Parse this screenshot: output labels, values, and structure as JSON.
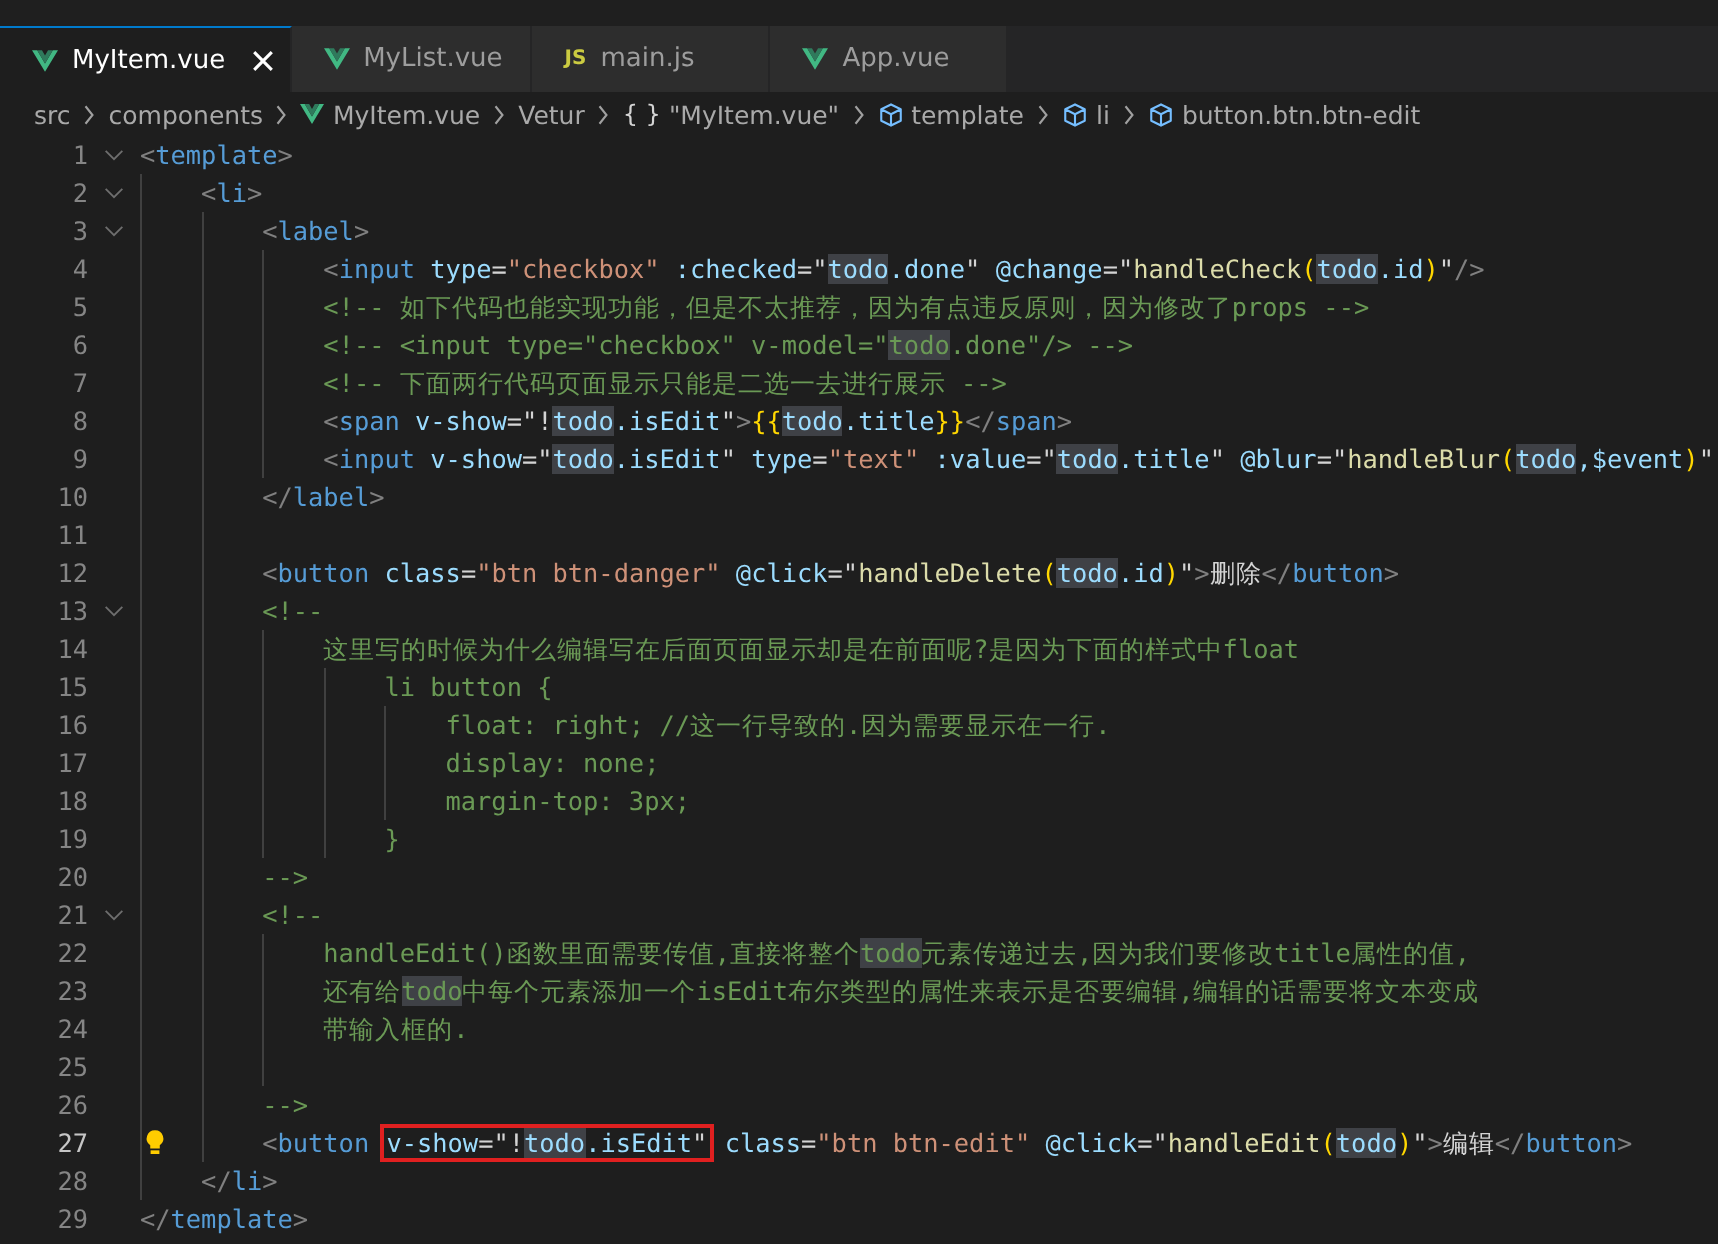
{
  "tabs": [
    {
      "label": "MyItem.vue",
      "kind": "vue",
      "selected": true
    },
    {
      "label": "MyList.vue",
      "kind": "vue",
      "selected": false
    },
    {
      "label": "main.js",
      "kind": "js",
      "icon_text": "JS",
      "selected": false
    },
    {
      "label": "App.vue",
      "kind": "vue",
      "selected": false
    }
  ],
  "breadcrumb": [
    {
      "label": "src"
    },
    {
      "label": "components"
    },
    {
      "label": "MyItem.vue",
      "kind": "vue"
    },
    {
      "label": "Vetur"
    },
    {
      "label": "\"MyItem.vue\"",
      "kind": "braces",
      "icon_text": "{ }"
    },
    {
      "label": "template",
      "kind": "symbol"
    },
    {
      "label": "li",
      "kind": "symbol"
    },
    {
      "label": "button.btn.btn-edit",
      "kind": "symbol"
    }
  ],
  "editor": {
    "lines": [
      {
        "number": "1",
        "foldable": true,
        "current": false,
        "lightbulb": false,
        "tokens": [
          {
            "kind": "punct",
            "text": "<"
          },
          {
            "kind": "tag",
            "text": "template"
          },
          {
            "kind": "punct",
            "text": ">"
          }
        ]
      },
      {
        "number": "2",
        "foldable": true,
        "current": false,
        "lightbulb": false,
        "tokens": [
          {
            "kind": "punct",
            "text": "    <"
          },
          {
            "kind": "tag",
            "text": "li"
          },
          {
            "kind": "punct",
            "text": ">"
          }
        ]
      },
      {
        "number": "3",
        "foldable": true,
        "current": false,
        "lightbulb": false,
        "tokens": [
          {
            "kind": "punct",
            "text": "        <"
          },
          {
            "kind": "tag",
            "text": "label"
          },
          {
            "kind": "punct",
            "text": ">"
          }
        ]
      },
      {
        "number": "4",
        "foldable": false,
        "current": false,
        "lightbulb": false,
        "tokens": [
          {
            "kind": "punct",
            "text": "            <"
          },
          {
            "kind": "tag",
            "text": "input"
          },
          {
            "kind": "attr",
            "text": " type"
          },
          {
            "kind": "plain",
            "text": "="
          },
          {
            "kind": "str",
            "text": "\"checkbox\""
          },
          {
            "kind": "attr",
            "text": " :checked"
          },
          {
            "kind": "plain",
            "text": "=\""
          },
          {
            "kind": "match",
            "text": "todo"
          },
          {
            "kind": "var",
            "text": ".done"
          },
          {
            "kind": "plain",
            "text": "\" "
          },
          {
            "kind": "attr",
            "text": "@change"
          },
          {
            "kind": "plain",
            "text": "=\""
          },
          {
            "kind": "func",
            "text": "handleCheck"
          },
          {
            "kind": "brace",
            "text": "("
          },
          {
            "kind": "match",
            "text": "todo"
          },
          {
            "kind": "var",
            "text": ".id"
          },
          {
            "kind": "brace",
            "text": ")"
          },
          {
            "kind": "plain",
            "text": "\""
          },
          {
            "kind": "punct",
            "text": "/>"
          }
        ]
      },
      {
        "number": "5",
        "foldable": false,
        "current": false,
        "lightbulb": false,
        "tokens": [
          {
            "kind": "comment",
            "text": "            <!-- 如下代码也能实现功能，但是不太推荐，因为有点违反原则，因为修改了props -->"
          }
        ]
      },
      {
        "number": "6",
        "foldable": false,
        "current": false,
        "lightbulb": false,
        "tokens": [
          {
            "kind": "comment",
            "text": "            <!-- <input type=\"checkbox\" v-model=\""
          },
          {
            "kind": "cmatch",
            "text": "todo"
          },
          {
            "kind": "comment",
            "text": ".done\"/> -->"
          }
        ]
      },
      {
        "number": "7",
        "foldable": false,
        "current": false,
        "lightbulb": false,
        "tokens": [
          {
            "kind": "comment",
            "text": "            <!-- 下面两行代码页面显示只能是二选一去进行展示 -->"
          }
        ]
      },
      {
        "number": "8",
        "foldable": false,
        "current": false,
        "lightbulb": false,
        "tokens": [
          {
            "kind": "punct",
            "text": "            <"
          },
          {
            "kind": "tag",
            "text": "span"
          },
          {
            "kind": "attr",
            "text": " v-show"
          },
          {
            "kind": "plain",
            "text": "=\"!"
          },
          {
            "kind": "match",
            "text": "todo"
          },
          {
            "kind": "var",
            "text": ".isEdit"
          },
          {
            "kind": "plain",
            "text": "\""
          },
          {
            "kind": "punct",
            "text": ">"
          },
          {
            "kind": "brace",
            "text": "{{"
          },
          {
            "kind": "match",
            "text": "todo"
          },
          {
            "kind": "var",
            "text": ".title"
          },
          {
            "kind": "brace",
            "text": "}}"
          },
          {
            "kind": "punct",
            "text": "</"
          },
          {
            "kind": "tag",
            "text": "span"
          },
          {
            "kind": "punct",
            "text": ">"
          }
        ]
      },
      {
        "number": "9",
        "foldable": false,
        "current": false,
        "lightbulb": false,
        "tokens": [
          {
            "kind": "punct",
            "text": "            <"
          },
          {
            "kind": "tag",
            "text": "input"
          },
          {
            "kind": "attr",
            "text": " v-show"
          },
          {
            "kind": "plain",
            "text": "=\""
          },
          {
            "kind": "match",
            "text": "todo"
          },
          {
            "kind": "var",
            "text": ".isEdit"
          },
          {
            "kind": "plain",
            "text": "\" "
          },
          {
            "kind": "attr",
            "text": "type"
          },
          {
            "kind": "plain",
            "text": "="
          },
          {
            "kind": "str",
            "text": "\"text\""
          },
          {
            "kind": "attr",
            "text": " :value"
          },
          {
            "kind": "plain",
            "text": "=\""
          },
          {
            "kind": "match",
            "text": "todo"
          },
          {
            "kind": "var",
            "text": ".title"
          },
          {
            "kind": "plain",
            "text": "\" "
          },
          {
            "kind": "attr",
            "text": "@blur"
          },
          {
            "kind": "plain",
            "text": "=\""
          },
          {
            "kind": "func",
            "text": "handleBlur"
          },
          {
            "kind": "brace",
            "text": "("
          },
          {
            "kind": "match",
            "text": "todo"
          },
          {
            "kind": "var",
            "text": ",$event"
          },
          {
            "kind": "brace",
            "text": ")"
          },
          {
            "kind": "plain",
            "text": "\""
          }
        ]
      },
      {
        "number": "10",
        "foldable": false,
        "current": false,
        "lightbulb": false,
        "tokens": [
          {
            "kind": "punct",
            "text": "        </"
          },
          {
            "kind": "tag",
            "text": "label"
          },
          {
            "kind": "punct",
            "text": ">"
          }
        ]
      },
      {
        "number": "11",
        "foldable": false,
        "current": false,
        "lightbulb": false
      },
      {
        "number": "12",
        "foldable": false,
        "current": false,
        "lightbulb": false,
        "tokens": [
          {
            "kind": "punct",
            "text": "        <"
          },
          {
            "kind": "tag",
            "text": "button"
          },
          {
            "kind": "attr",
            "text": " class"
          },
          {
            "kind": "plain",
            "text": "="
          },
          {
            "kind": "str",
            "text": "\"btn btn-danger\""
          },
          {
            "kind": "attr",
            "text": " @click"
          },
          {
            "kind": "plain",
            "text": "=\""
          },
          {
            "kind": "func",
            "text": "handleDelete"
          },
          {
            "kind": "brace",
            "text": "("
          },
          {
            "kind": "match",
            "text": "todo"
          },
          {
            "kind": "var",
            "text": ".id"
          },
          {
            "kind": "brace",
            "text": ")"
          },
          {
            "kind": "plain",
            "text": "\""
          },
          {
            "kind": "punct",
            "text": ">"
          },
          {
            "kind": "plain",
            "text": "删除"
          },
          {
            "kind": "punct",
            "text": "</"
          },
          {
            "kind": "tag",
            "text": "button"
          },
          {
            "kind": "punct",
            "text": ">"
          }
        ]
      },
      {
        "number": "13",
        "foldable": true,
        "current": false,
        "lightbulb": false,
        "tokens": [
          {
            "kind": "comment",
            "text": "        <!--"
          }
        ]
      },
      {
        "number": "14",
        "foldable": false,
        "current": false,
        "lightbulb": false,
        "tokens": [
          {
            "kind": "comment",
            "text": "            这里写的时候为什么编辑写在后面页面显示却是在前面呢?是因为下面的样式中float"
          }
        ]
      },
      {
        "number": "15",
        "foldable": false,
        "current": false,
        "lightbulb": false,
        "tokens": [
          {
            "kind": "comment",
            "text": "                li button {"
          }
        ]
      },
      {
        "number": "16",
        "foldable": false,
        "current": false,
        "lightbulb": false,
        "tokens": [
          {
            "kind": "comment",
            "text": "                    float: right; //这一行导致的.因为需要显示在一行."
          }
        ]
      },
      {
        "number": "17",
        "foldable": false,
        "current": false,
        "lightbulb": false,
        "tokens": [
          {
            "kind": "comment",
            "text": "                    display: none;"
          }
        ]
      },
      {
        "number": "18",
        "foldable": false,
        "current": false,
        "lightbulb": false,
        "tokens": [
          {
            "kind": "comment",
            "text": "                    margin-top: 3px;"
          }
        ]
      },
      {
        "number": "19",
        "foldable": false,
        "current": false,
        "lightbulb": false,
        "tokens": [
          {
            "kind": "comment",
            "text": "                }"
          }
        ]
      },
      {
        "number": "20",
        "foldable": false,
        "current": false,
        "lightbulb": false,
        "tokens": [
          {
            "kind": "comment",
            "text": "        -->"
          }
        ]
      },
      {
        "number": "21",
        "foldable": true,
        "current": false,
        "lightbulb": false,
        "tokens": [
          {
            "kind": "comment",
            "text": "        <!--"
          }
        ]
      },
      {
        "number": "22",
        "foldable": false,
        "current": false,
        "lightbulb": false,
        "tokens": [
          {
            "kind": "comment",
            "text": "            handleEdit()函数里面需要传值,直接将整个"
          },
          {
            "kind": "cmatch",
            "text": "todo"
          },
          {
            "kind": "comment",
            "text": "元素传递过去,因为我们要修改title属性的值,"
          }
        ]
      },
      {
        "number": "23",
        "foldable": false,
        "current": false,
        "lightbulb": false,
        "tokens": [
          {
            "kind": "comment",
            "text": "            还有给"
          },
          {
            "kind": "cmatch",
            "text": "todo"
          },
          {
            "kind": "comment",
            "text": "中每个元素添加一个isEdit布尔类型的属性来表示是否要编辑,编辑的话需要将文本变成"
          }
        ]
      },
      {
        "number": "24",
        "foldable": false,
        "current": false,
        "lightbulb": false,
        "tokens": [
          {
            "kind": "comment",
            "text": "            带输入框的."
          }
        ]
      },
      {
        "number": "25",
        "foldable": false,
        "current": false,
        "lightbulb": false
      },
      {
        "number": "26",
        "foldable": false,
        "current": false,
        "lightbulb": false,
        "tokens": [
          {
            "kind": "comment",
            "text": "        -->"
          }
        ]
      },
      {
        "number": "27",
        "foldable": false,
        "current": true,
        "lightbulb": true,
        "tokens": [
          {
            "kind": "punct",
            "text": "        <"
          },
          {
            "kind": "tag",
            "text": "button "
          },
          {
            "kind": "box",
            "tokens": [
              {
                "kind": "attr",
                "text": "v-show"
              },
              {
                "kind": "plain",
                "text": "=\"!"
              },
              {
                "kind": "match",
                "text": "todo"
              },
              {
                "kind": "var",
                "text": ".isEdit"
              },
              {
                "kind": "plain",
                "text": "\""
              }
            ]
          },
          {
            "kind": "attr",
            "text": " class"
          },
          {
            "kind": "plain",
            "text": "="
          },
          {
            "kind": "str",
            "text": "\"btn btn-edit\""
          },
          {
            "kind": "attr",
            "text": " @click"
          },
          {
            "kind": "plain",
            "text": "=\""
          },
          {
            "kind": "func",
            "text": "handleEdit"
          },
          {
            "kind": "brace",
            "text": "("
          },
          {
            "kind": "match",
            "text": "todo"
          },
          {
            "kind": "brace",
            "text": ")"
          },
          {
            "kind": "plain",
            "text": "\""
          },
          {
            "kind": "punct",
            "text": ">"
          },
          {
            "kind": "plain",
            "text": "编辑"
          },
          {
            "kind": "punct",
            "text": "</"
          },
          {
            "kind": "tag",
            "text": "button"
          },
          {
            "kind": "punct",
            "text": ">"
          }
        ]
      },
      {
        "number": "28",
        "foldable": false,
        "current": false,
        "lightbulb": false,
        "tokens": [
          {
            "kind": "punct",
            "text": "    </"
          },
          {
            "kind": "tag",
            "text": "li"
          },
          {
            "kind": "punct",
            "text": ">"
          }
        ]
      },
      {
        "number": "29",
        "foldable": false,
        "current": false,
        "lightbulb": false,
        "tokens": [
          {
            "kind": "punct",
            "text": "</"
          },
          {
            "kind": "tag",
            "text": "template"
          },
          {
            "kind": "punct",
            "text": ">"
          }
        ]
      }
    ]
  }
}
